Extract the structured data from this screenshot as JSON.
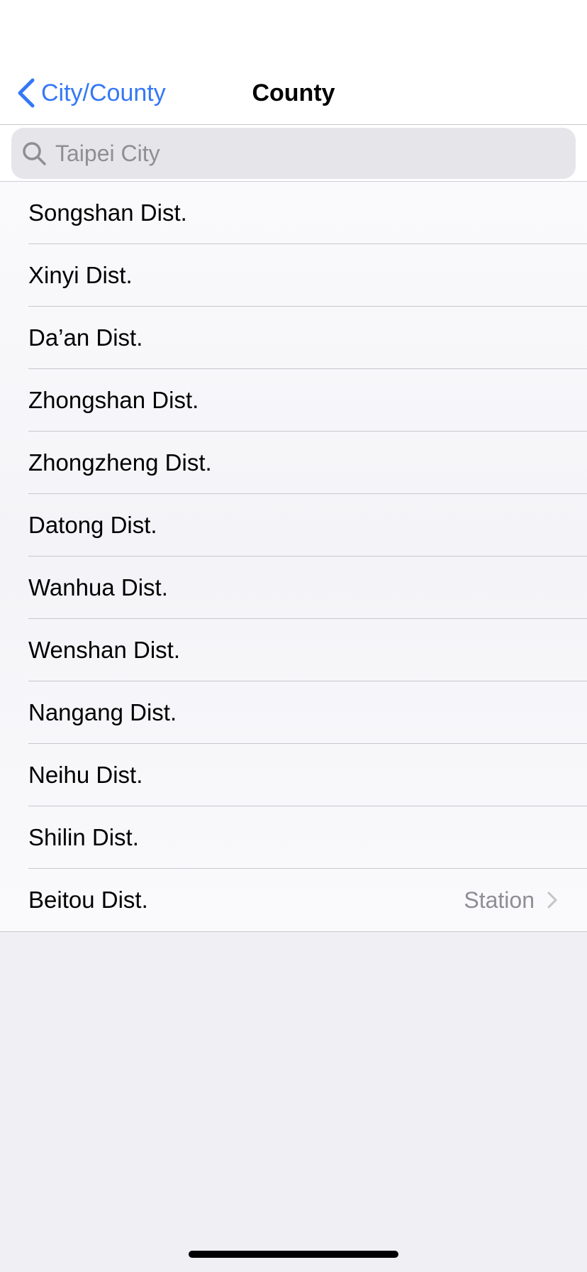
{
  "nav": {
    "back_label": "City/County",
    "title": "County"
  },
  "search": {
    "placeholder": "Taipei City",
    "value": ""
  },
  "districts": [
    {
      "label": "Songshan Dist.",
      "detail": ""
    },
    {
      "label": "Xinyi Dist.",
      "detail": ""
    },
    {
      "label": "Da’an Dist.",
      "detail": ""
    },
    {
      "label": "Zhongshan Dist.",
      "detail": ""
    },
    {
      "label": "Zhongzheng Dist.",
      "detail": ""
    },
    {
      "label": "Datong Dist.",
      "detail": ""
    },
    {
      "label": "Wanhua Dist.",
      "detail": ""
    },
    {
      "label": "Wenshan Dist.",
      "detail": ""
    },
    {
      "label": "Nangang Dist.",
      "detail": ""
    },
    {
      "label": "Neihu Dist.",
      "detail": ""
    },
    {
      "label": "Shilin Dist.",
      "detail": ""
    },
    {
      "label": "Beitou Dist.",
      "detail": "Station"
    }
  ],
  "colors": {
    "accent": "#3478f6",
    "secondary_text": "#8e8e93",
    "background": "#efeff4"
  },
  "icons": {
    "back": "chevron-left-icon",
    "search": "magnifying-glass-icon",
    "disclosure": "chevron-right-icon"
  }
}
